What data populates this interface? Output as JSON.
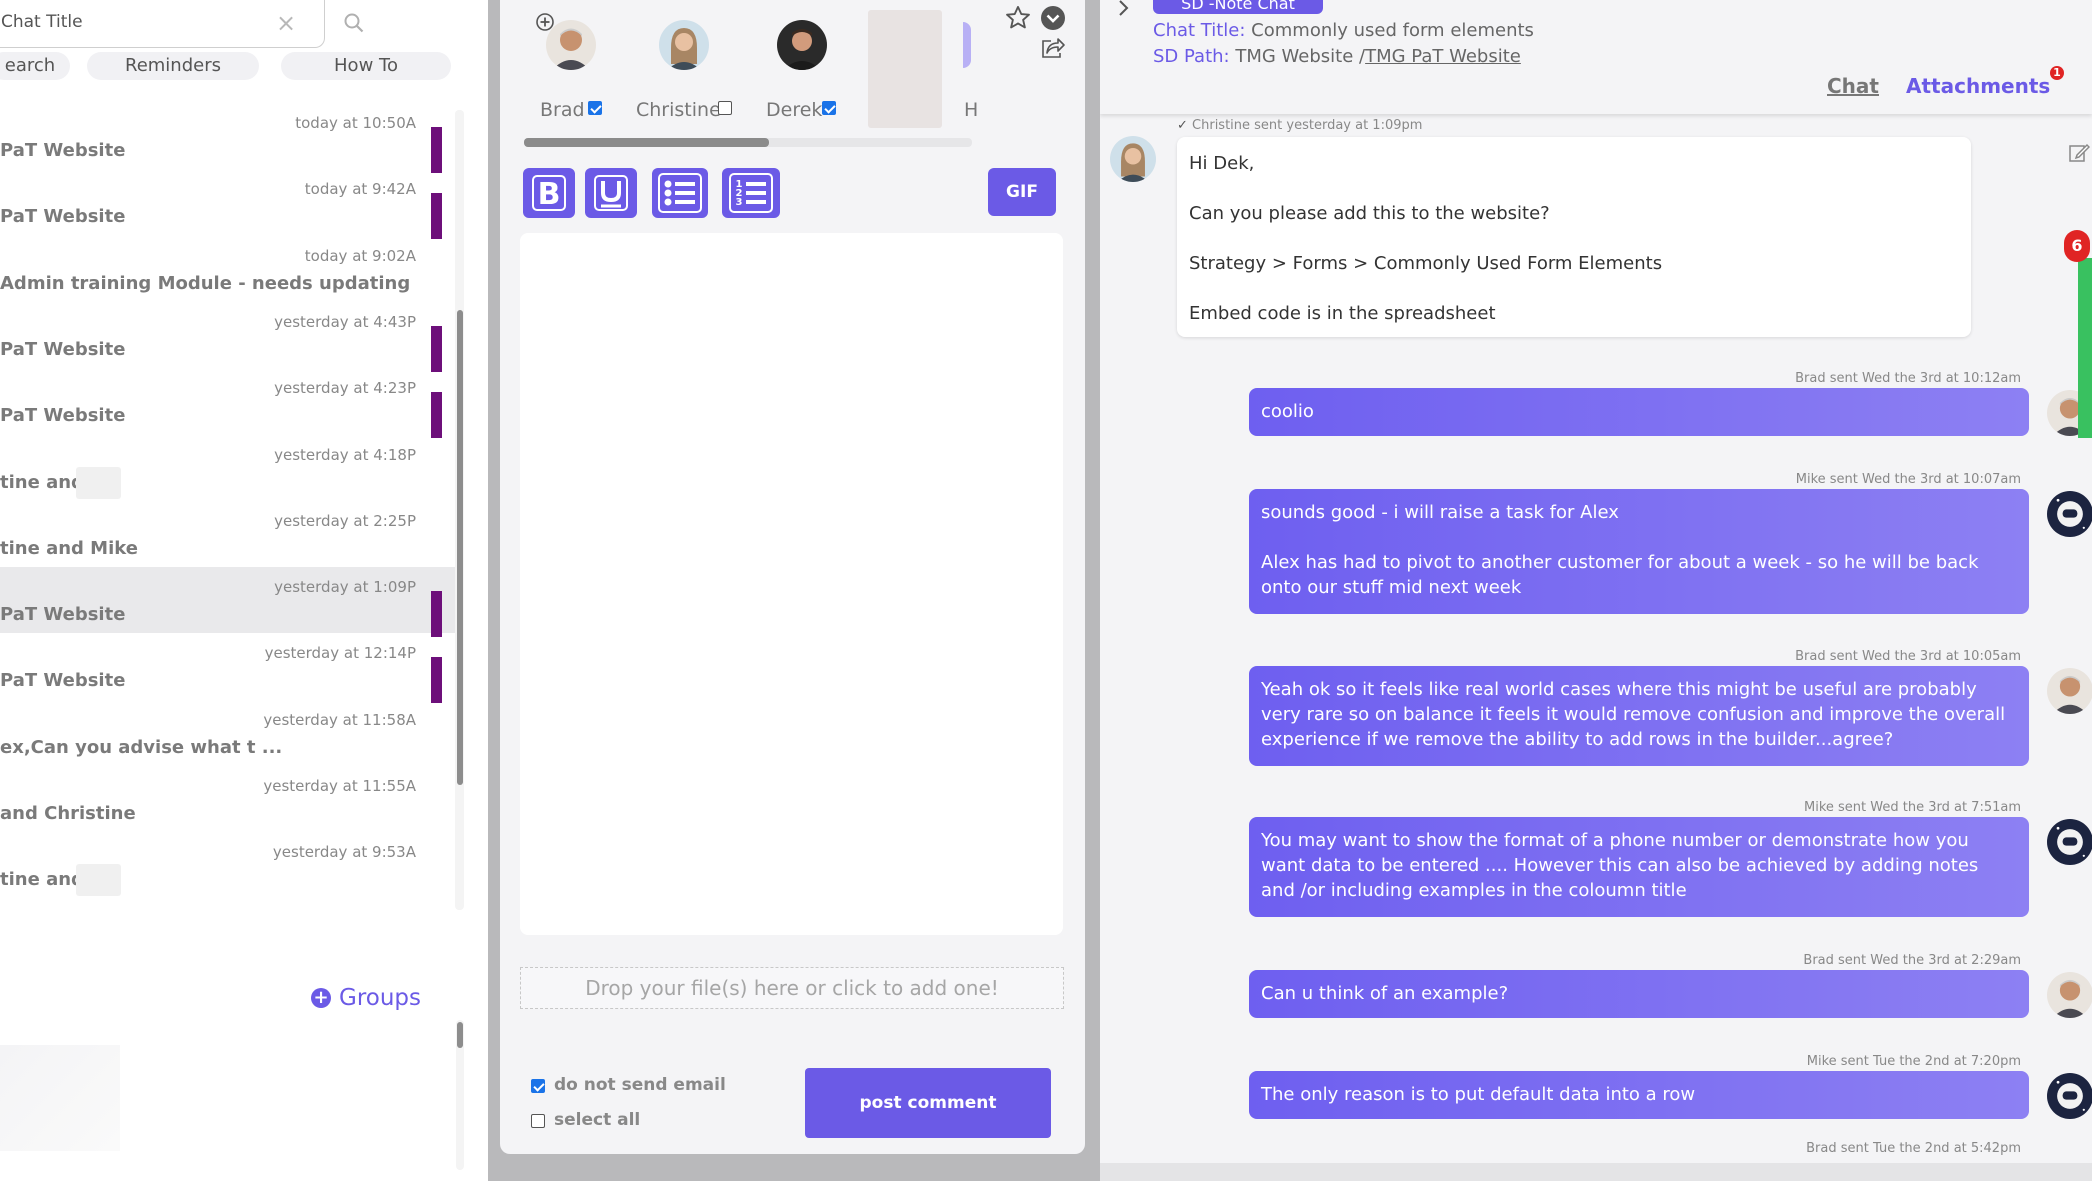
{
  "left": {
    "search_placeholder": "Chat Title",
    "tabs": [
      "earch",
      "Reminders",
      "How To"
    ],
    "chats": [
      {
        "time": "today at 10:50A",
        "title": "PaT Website",
        "bar": true,
        "blur": false,
        "selected": false
      },
      {
        "time": "today at 9:42A",
        "title": "PaT Website",
        "bar": true,
        "blur": false,
        "selected": false
      },
      {
        "time": "today at 9:02A",
        "title": "Admin training Module - needs updating",
        "bar": false,
        "blur": false,
        "selected": false
      },
      {
        "time": "yesterday at 4:43P",
        "title": "PaT Website",
        "bar": true,
        "blur": false,
        "selected": false
      },
      {
        "time": "yesterday at 4:23P",
        "title": "PaT Website",
        "bar": true,
        "blur": false,
        "selected": false
      },
      {
        "time": "yesterday at 4:18P",
        "title": "tine and",
        "bar": false,
        "blur": true,
        "selected": false
      },
      {
        "time": "yesterday at 2:25P",
        "title": "tine and Mike",
        "bar": false,
        "blur": false,
        "selected": false
      },
      {
        "time": "yesterday at 1:09P",
        "title": "PaT Website",
        "bar": true,
        "blur": false,
        "selected": true
      },
      {
        "time": "yesterday at 12:14P",
        "title": "PaT Website",
        "bar": true,
        "blur": false,
        "selected": false
      },
      {
        "time": "yesterday at 11:58A",
        "title": "ex,Can you advise what t ...",
        "bar": false,
        "blur": false,
        "selected": false
      },
      {
        "time": "yesterday at 11:55A",
        "title": "and Christine",
        "bar": false,
        "blur": false,
        "selected": false
      },
      {
        "time": "yesterday at 9:53A",
        "title": "tine and",
        "bar": false,
        "blur": true,
        "selected": false
      }
    ],
    "groups_label": "Groups"
  },
  "compose": {
    "participants": [
      {
        "name": "Brad",
        "checked": true
      },
      {
        "name": "Christine",
        "checked": false
      },
      {
        "name": "Derek",
        "checked": true
      },
      {
        "name": "H",
        "checked": false
      }
    ],
    "gif_label": "GIF",
    "dropzone_text": "Drop your file(s) here or click to add one!",
    "do_not_send_email_label": "do not send email",
    "do_not_send_email_checked": true,
    "select_all_label": "select all",
    "select_all_checked": false,
    "post_label": "post comment"
  },
  "chat": {
    "pill_label": "SD -Note Chat",
    "title_label": "Chat Title:",
    "title_value": "Commonly used form elements",
    "path_label": "SD Path:",
    "path_value_plain": "TMG Website /",
    "path_value_link": "TMG PaT Website",
    "tab_chat": "Chat",
    "tab_attachments": "Attachments",
    "attachments_count": "1",
    "side_count": "6",
    "incoming": {
      "meta": "Christine sent yesterday at 1:09pm",
      "text": "Hi Dek,\n\nCan you please add this to the website?\n\nStrategy > Forms > Commonly Used Form Elements\n\nEmbed code is in the spreadsheet"
    },
    "messages": [
      {
        "meta": "Brad sent Wed the 3rd at 10:12am",
        "text": "coolio",
        "sender": "brad"
      },
      {
        "meta": "Mike sent Wed the 3rd at 10:07am",
        "text": "sounds good - i will raise a task for Alex\n\nAlex has had to pivot to another customer for about a week - so he will be back onto our stuff mid next week",
        "sender": "mike"
      },
      {
        "meta": "Brad sent Wed the 3rd at 10:05am",
        "text": "Yeah ok so it feels like real world cases where this might be useful are probably very rare so on balance it feels it would remove confusion and improve the overall experience if we remove the ability to add rows in the builder...agree?",
        "sender": "brad"
      },
      {
        "meta": "Mike sent Wed the 3rd at 7:51am",
        "text": "You may want to show the format of a phone number or demonstrate how you want data to be entered .... However this can also be achieved by adding notes and /or including examples in the coloumn title",
        "sender": "mike"
      },
      {
        "meta": "Brad sent Wed the 3rd at 2:29am",
        "text": "Can u think of an example?",
        "sender": "brad"
      },
      {
        "meta": "Mike sent Tue the 2nd at 7:20pm",
        "text": "The only reason is to put default data into a row",
        "sender": "mike"
      },
      {
        "meta": "Brad sent Tue the 2nd at 5:42pm",
        "text": "",
        "sender": "brad"
      }
    ]
  },
  "colors": {
    "accent": "#6b5ae6",
    "chat_bar": "#6d0f7a",
    "badge": "#e02424",
    "online": "#39c160"
  }
}
